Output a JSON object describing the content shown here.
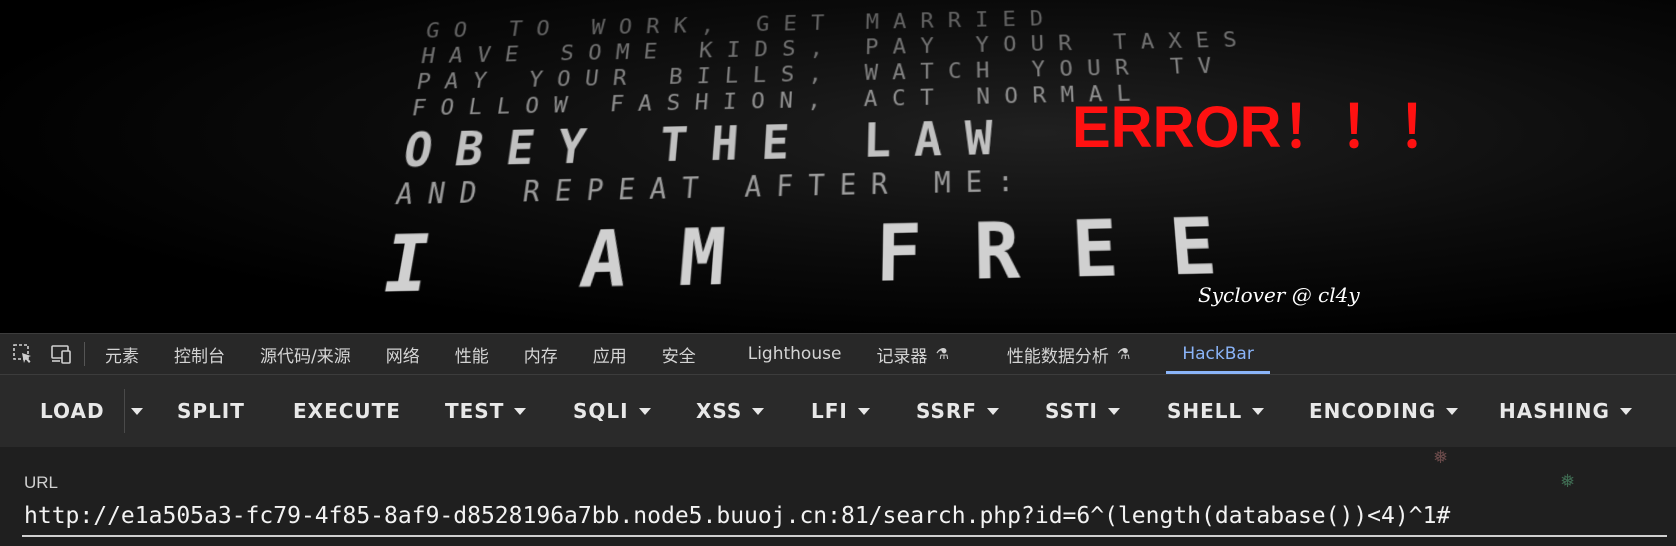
{
  "page": {
    "poster_lines": [
      "Go to work, get married",
      "have some kids, pay your taxes",
      "pay your bills, watch your TV",
      "follow fashion, act normal",
      "obey the law",
      "and repeat after me:",
      "I am free"
    ],
    "error_text": "ERROR！！！",
    "signature": "Syclover @ cl4y",
    "colors": {
      "error": "#ff1111",
      "background": "#000000"
    }
  },
  "devtools": {
    "tabs": [
      {
        "label": "元素"
      },
      {
        "label": "控制台"
      },
      {
        "label": "源代码/来源"
      },
      {
        "label": "网络"
      },
      {
        "label": "性能"
      },
      {
        "label": "内存"
      },
      {
        "label": "应用"
      },
      {
        "label": "安全"
      },
      {
        "label": "Lighthouse"
      },
      {
        "label": "记录器"
      },
      {
        "label": "性能数据分析"
      },
      {
        "label": "HackBar"
      }
    ],
    "active_tab": "HackBar",
    "icons": {
      "inspect": "inspect-element-icon",
      "device": "device-toolbar-icon",
      "experimental": "flask-icon"
    },
    "colors": {
      "accent": "#8ab4f8",
      "bar_bg": "#282828"
    }
  },
  "hackbar": {
    "buttons": [
      {
        "label": "LOAD"
      },
      {
        "label": "SPLIT"
      },
      {
        "label": "EXECUTE"
      },
      {
        "label": "TEST"
      },
      {
        "label": "SQLI"
      },
      {
        "label": "XSS"
      },
      {
        "label": "LFI"
      },
      {
        "label": "SSRF"
      },
      {
        "label": "SSTI"
      },
      {
        "label": "SHELL"
      },
      {
        "label": "ENCODING"
      },
      {
        "label": "HASHING"
      }
    ],
    "url_label": "URL",
    "url_value": "http://e1a505a3-fc79-4f85-8af9-d8528196a7bb.node5.buuoj.cn:81/search.php?id=6^(length(database())<4)^1#"
  }
}
